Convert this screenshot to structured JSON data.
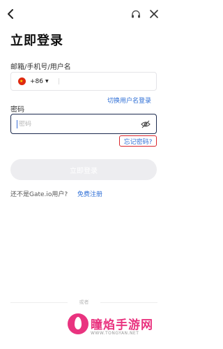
{
  "header": {
    "back_icon": "chevron-left-icon",
    "support_icon": "headset-icon",
    "close_icon": "close-icon"
  },
  "title": "立即登录",
  "account": {
    "label": "邮箱/手机号/用户名",
    "country_code": "+86",
    "flag": "china-flag-icon",
    "switch_link": "切换用户名登录"
  },
  "password": {
    "label": "密码",
    "placeholder": "密码",
    "value": "",
    "eye_icon": "eye-off-icon"
  },
  "forgot_link": "忘记密码?",
  "login_button": "立即登录",
  "register": {
    "prompt": "还不是Gate.io用户?",
    "link": "免费注册"
  },
  "or_text": "或者",
  "watermark": {
    "text": "瞳焰手游网",
    "url": "WWW.TONGYAN.NET"
  },
  "colors": {
    "accent": "#2f6fd6",
    "highlight_border": "#d9252b",
    "watermark": "#e9337f",
    "button_disabled": "#ededf0"
  }
}
